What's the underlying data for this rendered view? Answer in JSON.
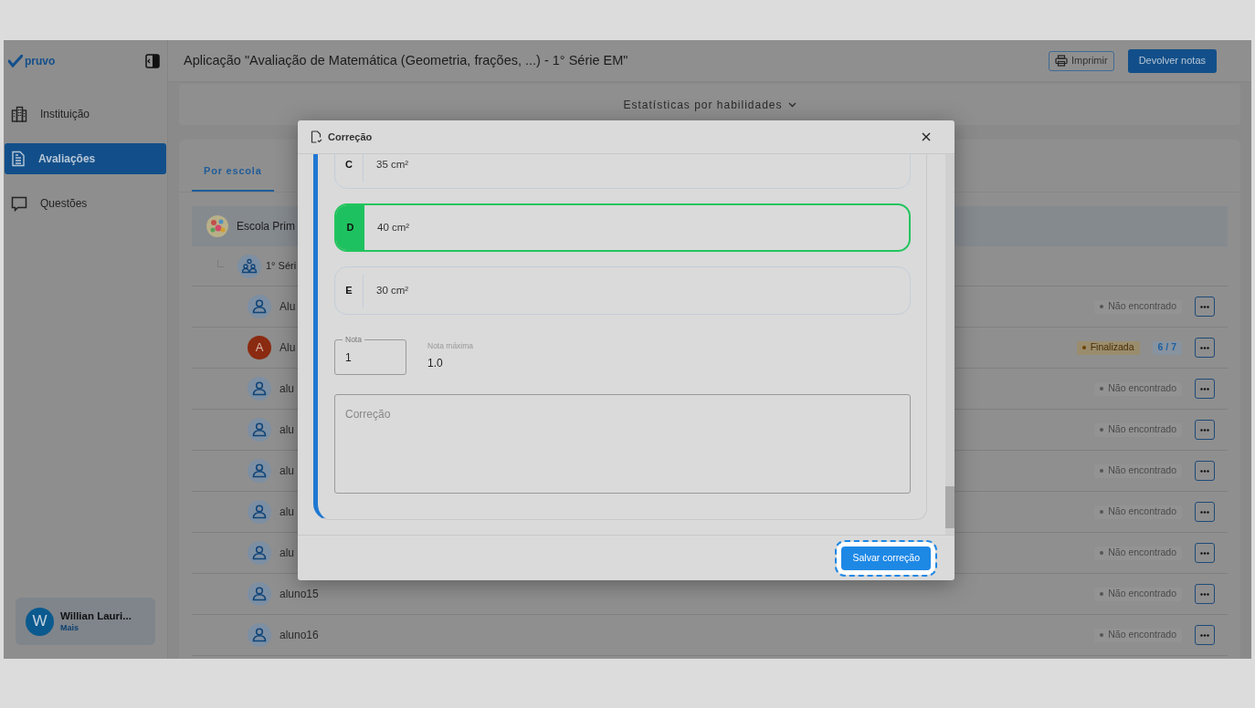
{
  "sidebar": {
    "logo": "pruvo",
    "items": [
      {
        "label": "Instituição",
        "kind": "building",
        "selected": false
      },
      {
        "label": "Avaliações",
        "kind": "document",
        "selected": true
      },
      {
        "label": "Questões",
        "kind": "chat",
        "selected": false
      }
    ],
    "user": {
      "initial": "W",
      "name": "Willian Lauri...",
      "link": "Mais"
    }
  },
  "header": {
    "title": "Aplicação \"Avaliação de Matemática (Geometria, frações, ...) - 1° Série EM\"",
    "buttons": [
      {
        "label": "Imprimir",
        "kind": "outline"
      },
      {
        "label": "Devolver notas",
        "kind": "primary"
      }
    ]
  },
  "stats_toggle": {
    "label": "Estatísticas por habilidades"
  },
  "tabs": [
    {
      "label": "Por escola",
      "selected": true
    }
  ],
  "school": {
    "name": "Escola Prim"
  },
  "class": {
    "name": "1° Séri"
  },
  "students": [
    {
      "name": "Alu",
      "kind": "icon",
      "status": {
        "label": "Não encontrado",
        "kind": "neutral"
      }
    },
    {
      "name": "Alu",
      "kind": "letter",
      "initial": "A",
      "status": {
        "label": "Finalizada",
        "kind": "done"
      },
      "score": "6 / 7"
    },
    {
      "name": "alu",
      "kind": "icon",
      "status": {
        "label": "Não encontrado",
        "kind": "neutral"
      }
    },
    {
      "name": "alu",
      "kind": "icon",
      "status": {
        "label": "Não encontrado",
        "kind": "neutral"
      }
    },
    {
      "name": "alu",
      "kind": "icon",
      "status": {
        "label": "Não encontrado",
        "kind": "neutral"
      }
    },
    {
      "name": "alu",
      "kind": "icon",
      "status": {
        "label": "Não encontrado",
        "kind": "neutral"
      }
    },
    {
      "name": "alu",
      "kind": "icon",
      "status": {
        "label": "Não encontrado",
        "kind": "neutral"
      }
    },
    {
      "name": "aluno15",
      "kind": "icon",
      "status": {
        "label": "Não encontrado",
        "kind": "neutral"
      }
    },
    {
      "name": "aluno16",
      "kind": "icon",
      "status": {
        "label": "Não encontrado",
        "kind": "neutral"
      }
    }
  ],
  "modal": {
    "title": "Correção",
    "options": [
      {
        "letter": "C",
        "text": "35 cm²",
        "correct": false
      },
      {
        "letter": "D",
        "text": "40 cm²",
        "correct": true
      },
      {
        "letter": "E",
        "text": "30 cm²",
        "correct": false
      }
    ],
    "grade": {
      "label": "Nota",
      "value": "1"
    },
    "max_grade": {
      "label": "Nota máxima",
      "value": "1.0"
    },
    "feedback": {
      "placeholder": "Correção"
    },
    "save_button": {
      "label": "Salvar correção",
      "focused": true
    }
  }
}
